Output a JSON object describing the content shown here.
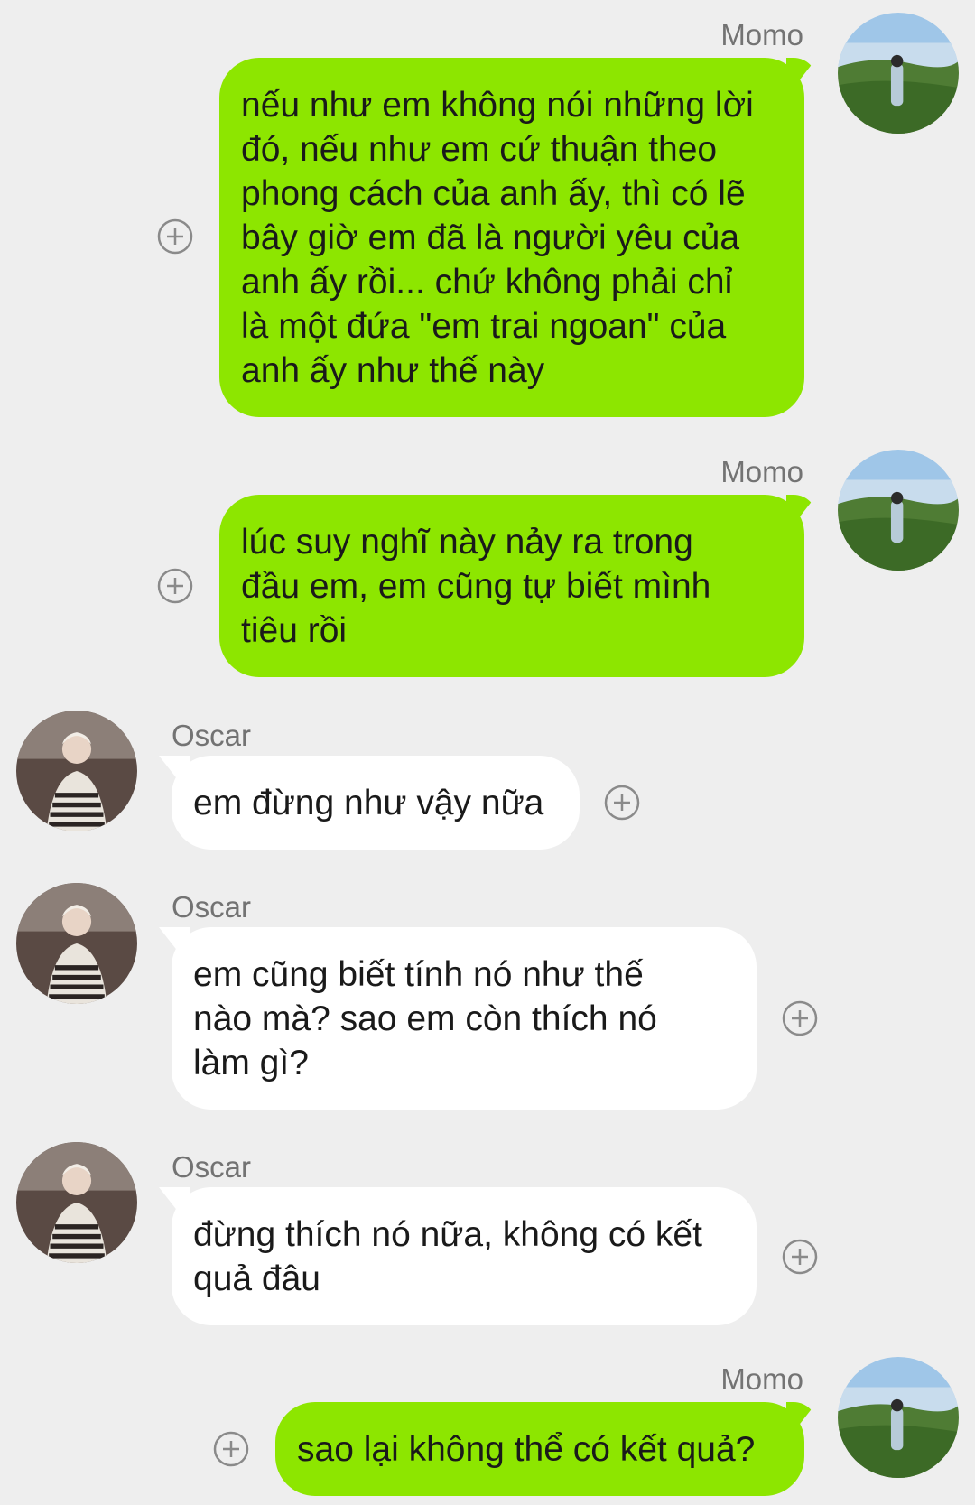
{
  "messages": [
    {
      "sender": "Momo",
      "lines": [
        "nếu như em không nói những lời",
        "đó, nếu như em cứ thuận theo",
        "phong cách của anh ấy, thì có lẽ",
        "bây giờ em đã là người yêu của",
        "anh ấy rồi... chứ không phải chỉ",
        "là một đứa \"em trai ngoan\" của",
        "anh ấy như thế này"
      ]
    },
    {
      "sender": "Momo",
      "lines": [
        "lúc suy nghĩ này nảy ra trong",
        "đầu em, em cũng tự biết mình",
        "tiêu rồi"
      ]
    },
    {
      "sender": "Oscar",
      "lines": [
        "em đừng như vậy nữa"
      ]
    },
    {
      "sender": "Oscar",
      "lines": [
        "em cũng biết tính nó như thế",
        "nào mà? sao em còn thích nó",
        "làm gì?"
      ]
    },
    {
      "sender": "Oscar",
      "lines": [
        "đừng thích nó nữa, không có kết",
        "quả đâu"
      ]
    },
    {
      "sender": "Momo",
      "lines": [
        "sao lại không thể có kết quả?"
      ]
    }
  ],
  "colors": {
    "background": "#eeeeee",
    "outgoing_bubble": "#8de600",
    "incoming_bubble": "#ffffff",
    "sender_name": "#737373"
  }
}
